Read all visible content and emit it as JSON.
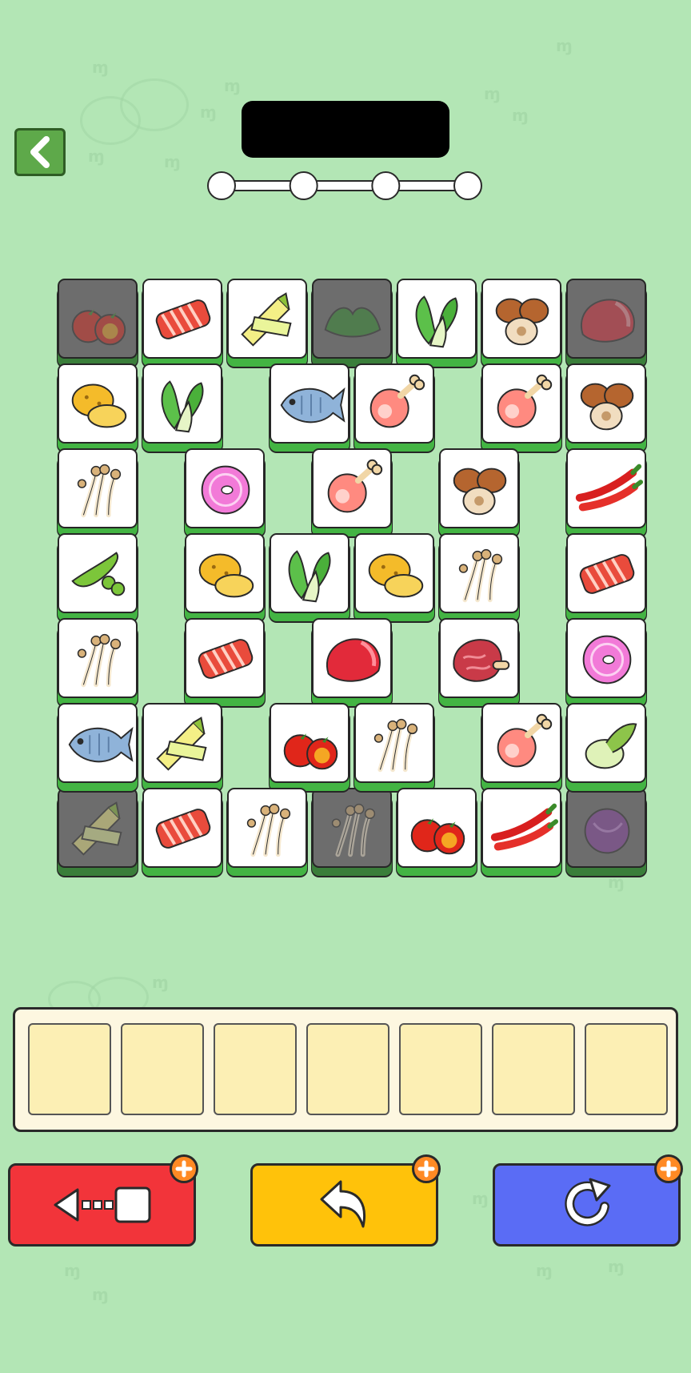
{
  "level": {
    "progress_steps": 4,
    "current_step": 1
  },
  "board": {
    "tiles": [
      {
        "row": 0,
        "col": 0,
        "item": "tomato",
        "layer": "under"
      },
      {
        "row": 0,
        "col": 1,
        "item": "salmon",
        "layer": "top"
      },
      {
        "row": 0,
        "col": 2,
        "item": "bamboo-shoots",
        "layer": "top"
      },
      {
        "row": 0,
        "col": 3,
        "item": "lettuce",
        "layer": "under"
      },
      {
        "row": 0,
        "col": 4,
        "item": "bok-choy",
        "layer": "top"
      },
      {
        "row": 0,
        "col": 5,
        "item": "shiitake",
        "layer": "top"
      },
      {
        "row": 0,
        "col": 6,
        "item": "beef",
        "layer": "under"
      },
      {
        "row": 1,
        "col": 0,
        "item": "potato",
        "layer": "top"
      },
      {
        "row": 1,
        "col": 1,
        "item": "bok-choy",
        "layer": "top"
      },
      {
        "row": 1,
        "col": 2.5,
        "item": "fish",
        "layer": "top"
      },
      {
        "row": 1,
        "col": 3.5,
        "item": "ham-leg",
        "layer": "top"
      },
      {
        "row": 1,
        "col": 5,
        "item": "ham-leg",
        "layer": "top"
      },
      {
        "row": 1,
        "col": 6,
        "item": "shiitake",
        "layer": "top"
      },
      {
        "row": 2,
        "col": 0,
        "item": "enoki",
        "layer": "top"
      },
      {
        "row": 2,
        "col": 1.5,
        "item": "onion",
        "layer": "top"
      },
      {
        "row": 2,
        "col": 3,
        "item": "ham-leg",
        "layer": "top"
      },
      {
        "row": 2,
        "col": 4.5,
        "item": "shiitake",
        "layer": "top"
      },
      {
        "row": 2,
        "col": 6,
        "item": "chili",
        "layer": "top"
      },
      {
        "row": 3,
        "col": 0,
        "item": "edamame",
        "layer": "top"
      },
      {
        "row": 3,
        "col": 1.5,
        "item": "potato",
        "layer": "top"
      },
      {
        "row": 3,
        "col": 2.5,
        "item": "bok-choy",
        "layer": "top"
      },
      {
        "row": 3,
        "col": 3.5,
        "item": "potato",
        "layer": "top"
      },
      {
        "row": 3,
        "col": 4.5,
        "item": "enoki",
        "layer": "top"
      },
      {
        "row": 3,
        "col": 6,
        "item": "salmon",
        "layer": "top"
      },
      {
        "row": 4,
        "col": 0,
        "item": "enoki",
        "layer": "top"
      },
      {
        "row": 4,
        "col": 1.5,
        "item": "salmon",
        "layer": "top"
      },
      {
        "row": 4,
        "col": 3,
        "item": "beef",
        "layer": "top"
      },
      {
        "row": 4,
        "col": 4.5,
        "item": "steak",
        "layer": "top"
      },
      {
        "row": 4,
        "col": 6,
        "item": "onion",
        "layer": "top"
      },
      {
        "row": 5,
        "col": 0,
        "item": "fish",
        "layer": "top"
      },
      {
        "row": 5,
        "col": 1,
        "item": "bamboo-shoots",
        "layer": "top"
      },
      {
        "row": 5,
        "col": 2.5,
        "item": "tomato",
        "layer": "top"
      },
      {
        "row": 5,
        "col": 3.5,
        "item": "enoki",
        "layer": "top"
      },
      {
        "row": 5,
        "col": 5,
        "item": "ham-leg",
        "layer": "top"
      },
      {
        "row": 5,
        "col": 6,
        "item": "cucumber",
        "layer": "top"
      },
      {
        "row": 6,
        "col": 0,
        "item": "bamboo-shoots",
        "layer": "under"
      },
      {
        "row": 6,
        "col": 1,
        "item": "salmon",
        "layer": "top"
      },
      {
        "row": 6,
        "col": 2,
        "item": "enoki",
        "layer": "top"
      },
      {
        "row": 6,
        "col": 3,
        "item": "enoki",
        "layer": "under"
      },
      {
        "row": 6,
        "col": 4,
        "item": "tomato",
        "layer": "top"
      },
      {
        "row": 6,
        "col": 5,
        "item": "chili",
        "layer": "top"
      },
      {
        "row": 6,
        "col": 6,
        "item": "red-cabbage",
        "layer": "under"
      }
    ]
  },
  "tray": {
    "slot_count": 7,
    "slots": [
      "",
      "",
      "",
      "",
      "",
      "",
      ""
    ]
  },
  "powerups": [
    {
      "name": "move-out",
      "icon": "move-out-icon",
      "color": "#f2343a",
      "badge": "plus-icon"
    },
    {
      "name": "undo",
      "icon": "undo-icon",
      "color": "#ffc20a",
      "badge": "plus-icon"
    },
    {
      "name": "shuffle",
      "icon": "shuffle-icon",
      "color": "#5a6cf5",
      "badge": "plus-icon"
    }
  ],
  "colors": {
    "background": "#b3e6b5",
    "tile_face": "#ffffff",
    "tile_side": "#43b443",
    "back_button": "#5ea94a",
    "tray": "#fdf7e0",
    "slot": "#fcefb4"
  }
}
